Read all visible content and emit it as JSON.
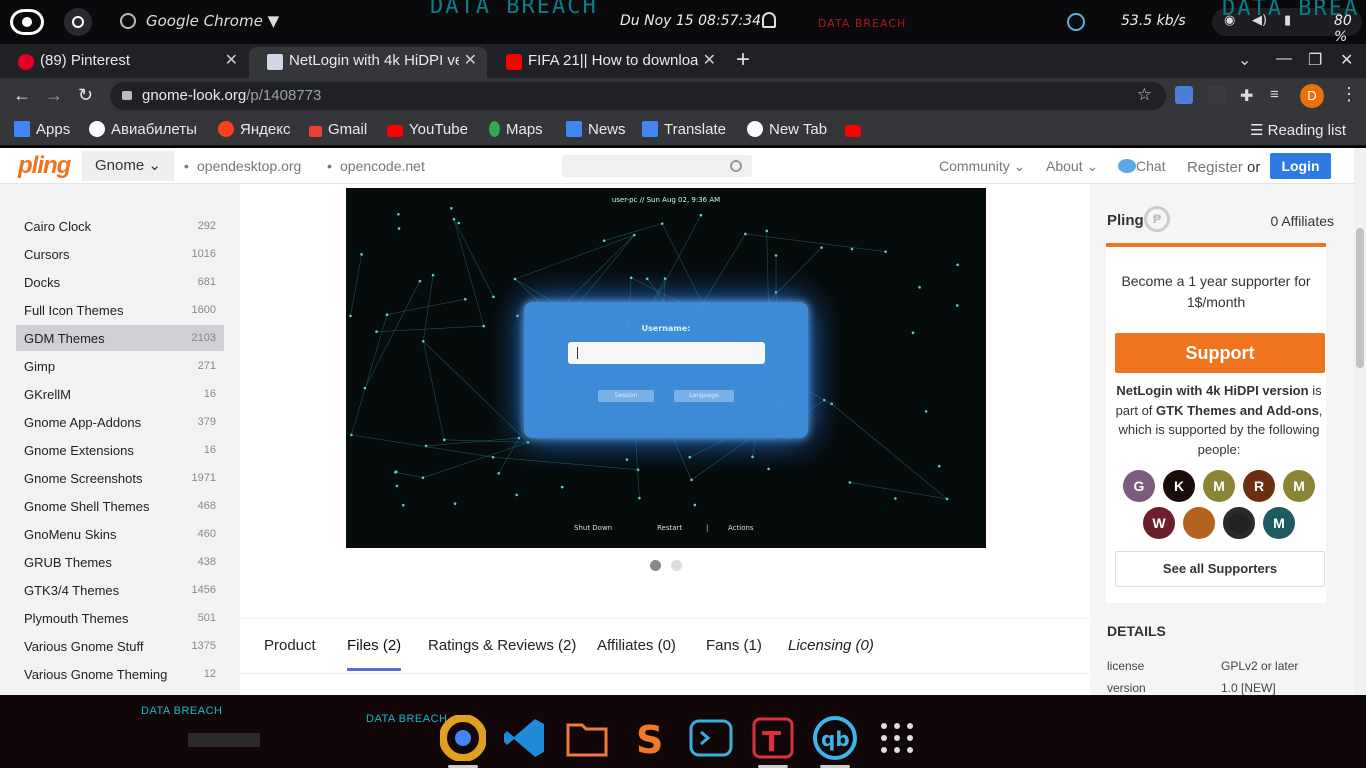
{
  "system_bar": {
    "app_name": "Google Chrome",
    "watermark_1": "DATA BREACH",
    "watermark_2": "DATA BREACH",
    "watermark_3": "DATA BREA",
    "clock": "Du Noy 15  08:57:34",
    "net_speed": "53.5 kb/s",
    "battery": "80 %"
  },
  "tabs": [
    {
      "label": "(89) Pinterest",
      "close": "✕"
    },
    {
      "label": "NetLogin with 4k HiDPI ve",
      "close": "✕"
    },
    {
      "label": "FIFA 21|| How to downloa",
      "close": "✕"
    }
  ],
  "new_tab": "+",
  "address": {
    "domain": "gnome-look.org",
    "path": "/p/1408773",
    "avatar": "D"
  },
  "bookmarks": [
    {
      "label": "Apps",
      "color": "#4285f4"
    },
    {
      "label": "Авиабилеты",
      "color": "#ffffff"
    },
    {
      "label": "Яндекс",
      "color": "#fc3f1d"
    },
    {
      "label": "Gmail",
      "color": "#ea4335"
    },
    {
      "label": "YouTube",
      "color": "#ff0000"
    },
    {
      "label": "Maps",
      "color": "#34a853"
    },
    {
      "label": "News",
      "color": "#4285f4"
    },
    {
      "label": "Translate",
      "color": "#4285f4"
    },
    {
      "label": "New Tab",
      "color": "#ffffff"
    },
    {
      "label": "",
      "color": "#ff0000"
    }
  ],
  "reading_list": "Reading list",
  "site": {
    "logo": "pling",
    "store": "Gnome ⌄",
    "links": [
      "opendesktop.org",
      "opencode.net"
    ],
    "menu": [
      "Community ⌄",
      "About ⌄",
      "Chat",
      "Register",
      "or"
    ],
    "login": "Login",
    "accent": "#f0731f"
  },
  "categories": [
    {
      "name": "Cairo Clock",
      "count": "292"
    },
    {
      "name": "Cursors",
      "count": "1016"
    },
    {
      "name": "Docks",
      "count": "681"
    },
    {
      "name": "Full Icon Themes",
      "count": "1600"
    },
    {
      "name": "GDM Themes",
      "count": "2103"
    },
    {
      "name": "Gimp",
      "count": "271"
    },
    {
      "name": "GKrellM",
      "count": "16"
    },
    {
      "name": "Gnome App-Addons",
      "count": "379"
    },
    {
      "name": "Gnome Extensions",
      "count": "16"
    },
    {
      "name": "Gnome Screenshots",
      "count": "1971"
    },
    {
      "name": "Gnome Shell Themes",
      "count": "468"
    },
    {
      "name": "GnoMenu Skins",
      "count": "460"
    },
    {
      "name": "GRUB Themes",
      "count": "438"
    },
    {
      "name": "GTK3/4 Themes",
      "count": "1456"
    },
    {
      "name": "Plymouth Themes",
      "count": "501"
    },
    {
      "name": "Various Gnome Stuff",
      "count": "1375"
    },
    {
      "name": "Various Gnome Theming",
      "count": "12"
    }
  ],
  "selected_category": "GDM Themes",
  "preview": {
    "top_info": "user-pc //  Sun Aug 02,  9:36 AM",
    "username_label": "Username:",
    "session": "Session",
    "language": "Language",
    "shutdown": "Shut Down",
    "restart": "Restart",
    "separator": "|",
    "actions": "Actions"
  },
  "product_tabs": [
    "Product",
    "Files (2)",
    "Ratings & Reviews (2)",
    "Affiliates (0)",
    "Fans (1)",
    "Licensing (0)"
  ],
  "active_product_tab": "Files (2)",
  "right_panel": {
    "pling_label": "Pling",
    "pling_badge": "₱",
    "affiliates": "0 Affiliates",
    "supporter_text": "Become a 1 year supporter for 1$/month",
    "support_button": "Support",
    "product_name": "NetLogin with 4k HiDPI version",
    "is_part_of": "is part of",
    "parent": "GTK Themes and Add-ons",
    "supported_text": ", which is supported by the following people:",
    "supporters": [
      {
        "letter": "G",
        "color": "#7b5b7e"
      },
      {
        "letter": "K",
        "color": "#1a0b0b"
      },
      {
        "letter": "M",
        "color": "#8a8434"
      },
      {
        "letter": "R",
        "color": "#6b2e10"
      },
      {
        "letter": "M",
        "color": "#8a8434"
      },
      {
        "letter": "W",
        "color": "#6b1f2a"
      },
      {
        "letter": "",
        "color": "#b5621f"
      },
      {
        "letter": "",
        "color": "#222222"
      },
      {
        "letter": "M",
        "color": "#1e5a5f"
      }
    ],
    "see_all": "See all Supporters",
    "details_title": "DETAILS",
    "details": [
      {
        "key": "license",
        "value": "GPLv2 or later"
      },
      {
        "key": "version",
        "value": "1.0 [NEW]"
      }
    ]
  },
  "taskbar": {
    "watermark_1": "DATA BREACH",
    "watermark_2": "DATA BREACH"
  }
}
